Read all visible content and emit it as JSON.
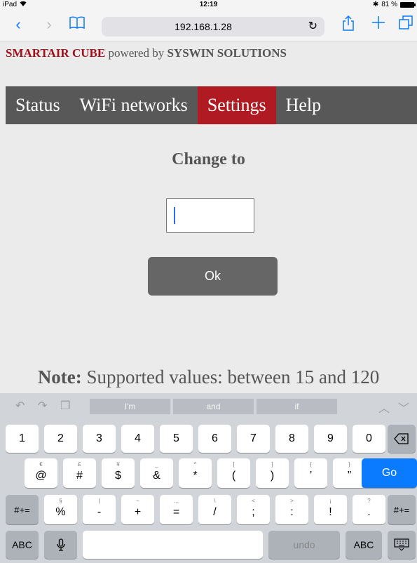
{
  "status_bar": {
    "device": "iPad",
    "time": "12:19",
    "battery": "81 %"
  },
  "browser": {
    "url": "192.168.1.28"
  },
  "brand": {
    "name": "SMARTAIR CUBE",
    "middle": "powered by",
    "company": "SYSWIN SOLUTIONS"
  },
  "nav": {
    "items": [
      {
        "label": "Status",
        "active": false
      },
      {
        "label": "WiFi networks",
        "active": false
      },
      {
        "label": "Settings",
        "active": true
      },
      {
        "label": "Help",
        "active": false
      }
    ]
  },
  "form": {
    "heading": "Change to",
    "input_value": "",
    "ok_label": "Ok"
  },
  "note": {
    "label": "Note:",
    "text": "Supported values: between 15 and 120"
  },
  "keyboard": {
    "suggestions": [
      "I'm",
      "and",
      "if"
    ],
    "row1": [
      "1",
      "2",
      "3",
      "4",
      "5",
      "6",
      "7",
      "8",
      "9",
      "0"
    ],
    "row2": [
      {
        "main": "@",
        "sub": "€"
      },
      {
        "main": "#",
        "sub": "£"
      },
      {
        "main": "$",
        "sub": "¥"
      },
      {
        "main": "&",
        "sub": "_"
      },
      {
        "main": "*",
        "sub": "^"
      },
      {
        "main": "(",
        "sub": "["
      },
      {
        "main": ")",
        "sub": "]"
      },
      {
        "main": "’",
        "sub": "{"
      },
      {
        "main": "”",
        "sub": "}"
      }
    ],
    "go_label": "Go",
    "row3": [
      {
        "main": "%",
        "sub": "§"
      },
      {
        "main": "-",
        "sub": "|"
      },
      {
        "main": "+",
        "sub": "~"
      },
      {
        "main": "=",
        "sub": "…"
      },
      {
        "main": "/",
        "sub": "\\"
      },
      {
        "main": ";",
        "sub": "<"
      },
      {
        "main": ":",
        "sub": ">"
      },
      {
        "main": "!",
        "sub": "¡"
      },
      {
        "main": ".",
        "sub": "?"
      }
    ],
    "symbols_label": "#+=",
    "abc_label": "ABC",
    "undo_label": "undo"
  }
}
